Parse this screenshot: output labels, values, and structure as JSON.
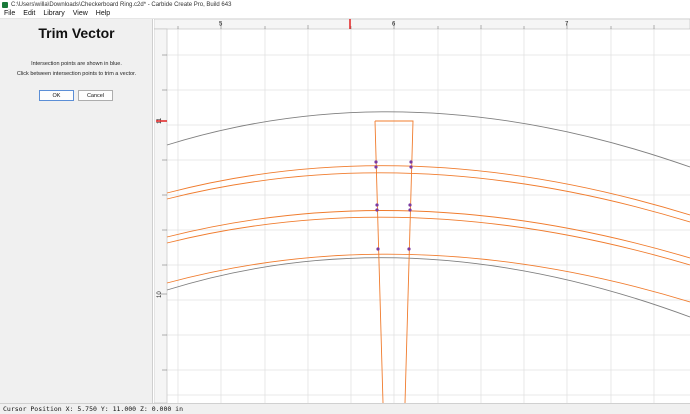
{
  "window": {
    "title": "C:\\Users\\willa\\Downloads\\Checkerboard Ring.c2d* - Carbide Create Pro, Build 643"
  },
  "menu": {
    "items": [
      "File",
      "Edit",
      "Library",
      "View",
      "Help"
    ]
  },
  "panel": {
    "title": "Trim Vector",
    "line1": "Intersection points are shown in blue.",
    "line2": "Click between intersection points to trim a vector.",
    "ok_label": "OK",
    "cancel_label": "Cancel"
  },
  "ruler": {
    "top_labels": [
      "5",
      "6",
      "7"
    ],
    "left_labels": [
      "11",
      "10"
    ]
  },
  "status": {
    "text": "Cursor Position X: 5.750 Y: 11.000 Z: 0.000 in"
  },
  "colors": {
    "vector_orange": "#f07c2e",
    "vector_gray": "#7f7f7f",
    "intersection_point": "#7a3aa0",
    "cursor_marker": "#e02020"
  }
}
